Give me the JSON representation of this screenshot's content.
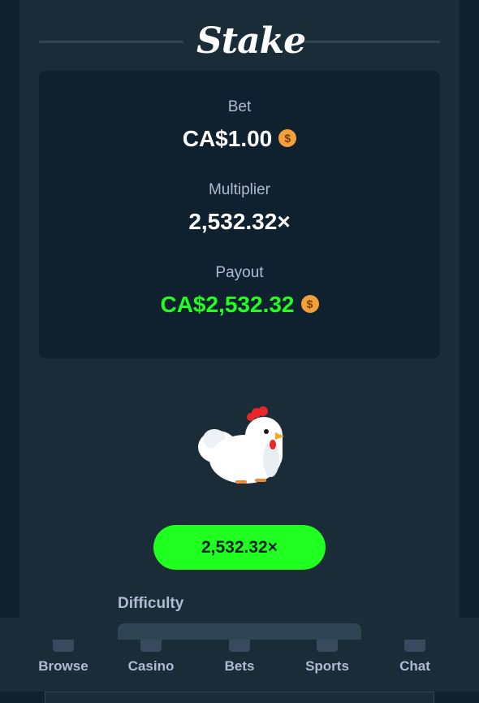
{
  "bottom_nav": {
    "items": [
      {
        "label": "Browse",
        "icon": "search-icon"
      },
      {
        "label": "Casino",
        "icon": "cards-icon"
      },
      {
        "label": "Bets",
        "icon": "receipt-icon"
      },
      {
        "label": "Sports",
        "icon": "ball-icon"
      },
      {
        "label": "Chat",
        "icon": "chat-icon"
      }
    ]
  },
  "modal": {
    "logo": "Stake",
    "bet_label": "Bet",
    "bet_value": "CA$1.00",
    "multiplier_label": "Multiplier",
    "multiplier_value": "2,532.32×",
    "payout_label": "Payout",
    "payout_value": "CA$2,532.32",
    "currency_icon": "dollar-coin-icon",
    "coin_symbol": "$",
    "game_icon": "chicken-icon",
    "result_button": "2,532.32×",
    "difficulty_label": "Difficulty"
  },
  "colors": {
    "background": "#0f212e",
    "panel": "#1a2c38",
    "accent_green": "#1fff20",
    "label": "#b1bad3",
    "coin": "#f2a13a"
  }
}
